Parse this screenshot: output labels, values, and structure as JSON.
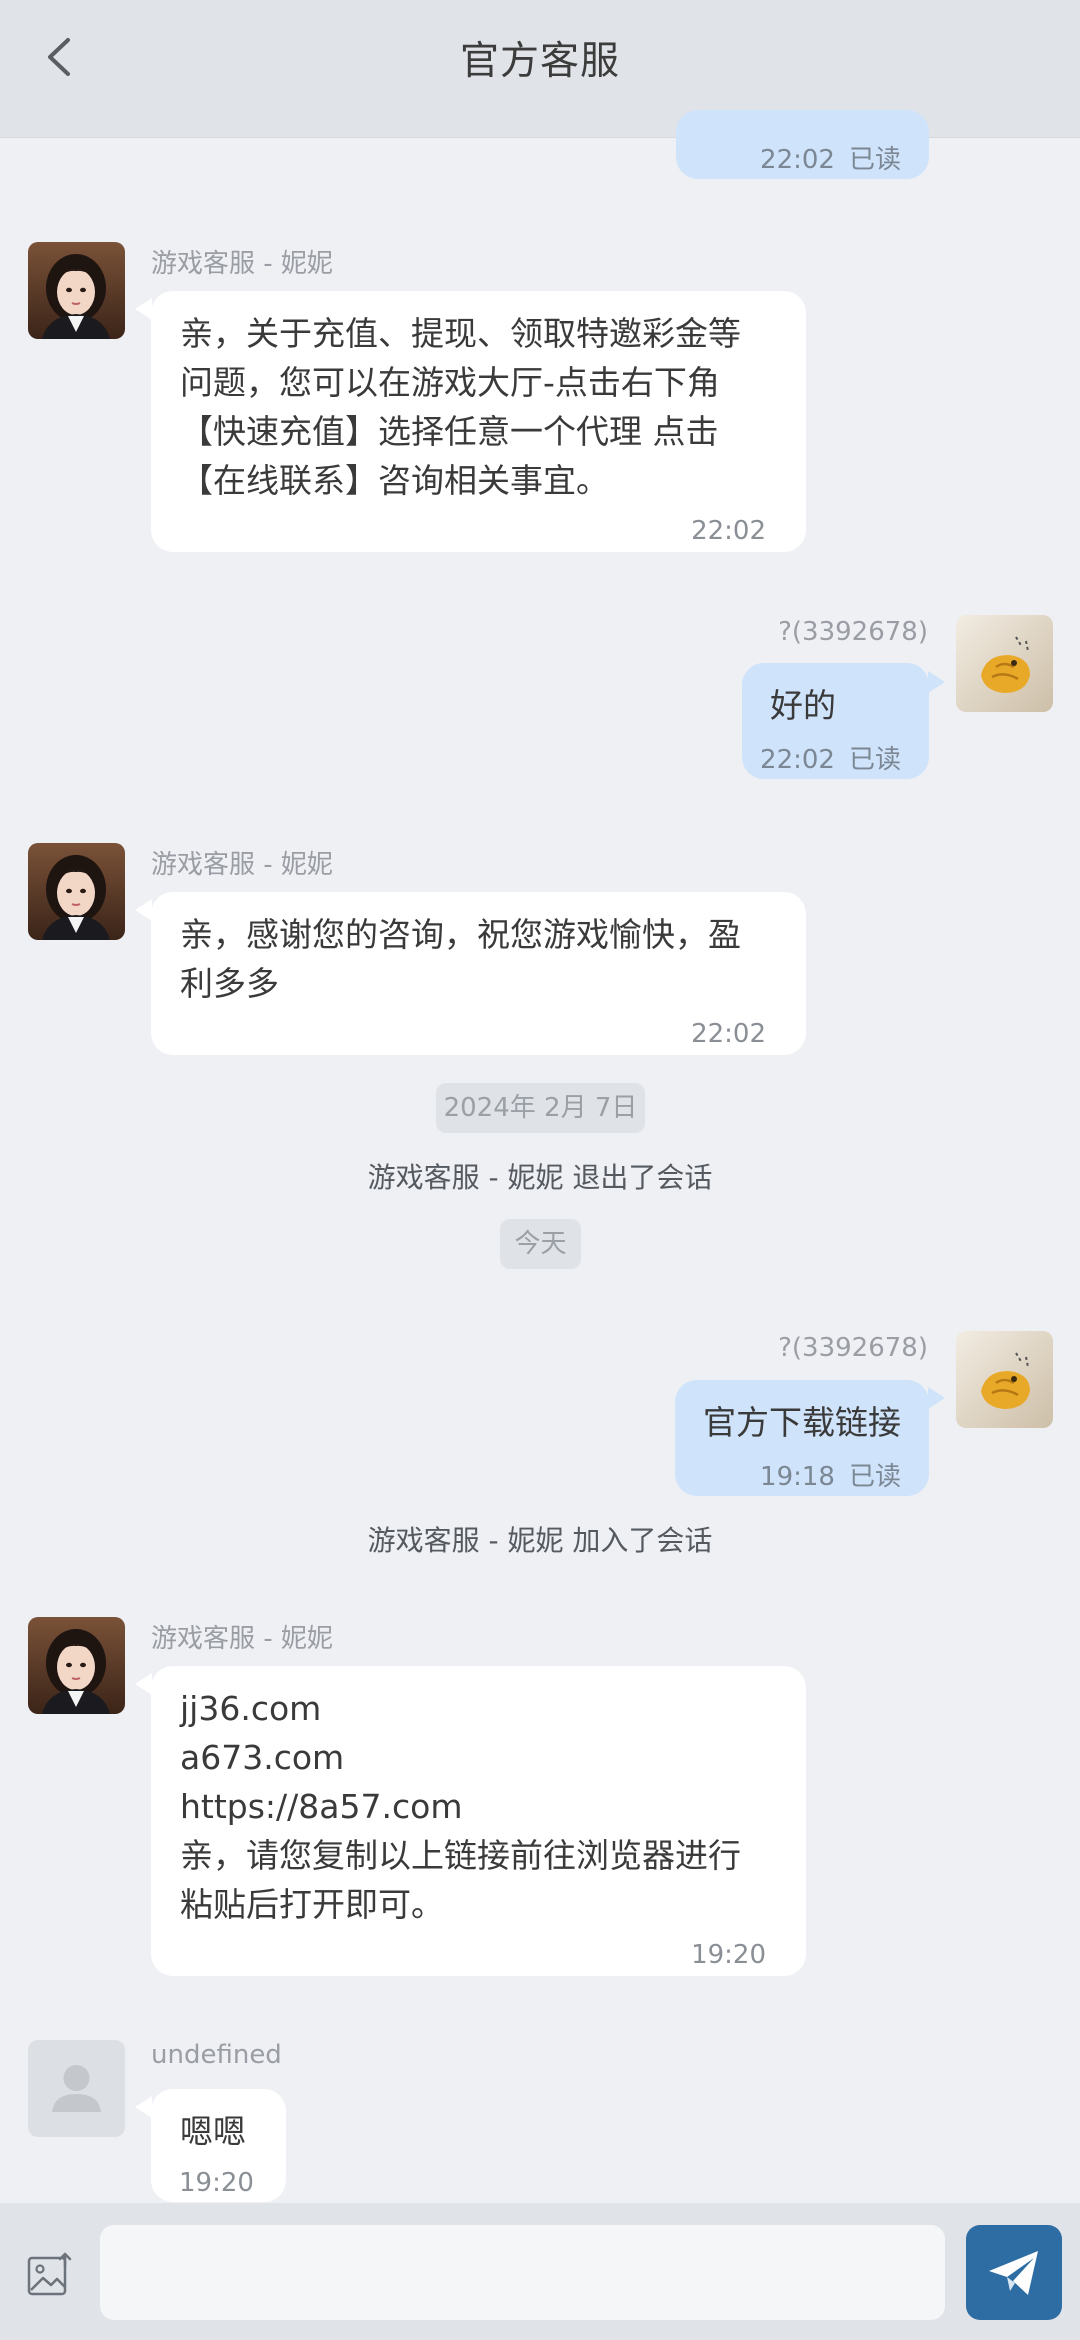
{
  "header": {
    "title": "官方客服"
  },
  "agent_name": "游戏客服 - 妮妮",
  "user_name": "?(3392678)",
  "unknown_name": "undefined",
  "read_label": "已读",
  "messages": {
    "m0": {
      "time": "22:02"
    },
    "m1": {
      "lines": [
        "亲，关于充值、提现、领取特邀彩金等",
        "问题，您可以在游戏大厅-点击右下角",
        "【快速充值】选择任意一个代理 点击",
        "【在线联系】咨询相关事宜。"
      ],
      "time": "22:02"
    },
    "m2": {
      "text": "好的",
      "time": "22:02"
    },
    "m3": {
      "lines": [
        "亲，感谢您的咨询，祝您游戏愉快，盈",
        "利多多"
      ],
      "time": "22:02"
    },
    "m4": {
      "text": "官方下载链接",
      "time": "19:18"
    },
    "m5": {
      "lines": [
        "jj36.com",
        "a673.com",
        "https://8a57.com",
        "亲，请您复制以上链接前往浏览器进行",
        "粘贴后打开即可。"
      ],
      "time": "19:20"
    },
    "m6": {
      "text": "嗯嗯",
      "time": "19:20"
    }
  },
  "separators": {
    "date1": "2024年 2月 7日",
    "left_session": "游戏客服 - 妮妮 退出了会话",
    "today": "今天",
    "joined_session": "游戏客服 - 妮妮 加入了会话"
  },
  "composer": {
    "placeholder": ""
  },
  "icons": {
    "back": "chevron-left-icon",
    "image": "image-upload-icon",
    "send": "paper-plane-icon"
  },
  "colors": {
    "header_bg": "#e0e3e7",
    "page_bg": "#eef0f4",
    "incoming_bubble": "#ffffff",
    "outgoing_bubble": "#cfe3fb",
    "send_button": "#2d6da3"
  }
}
